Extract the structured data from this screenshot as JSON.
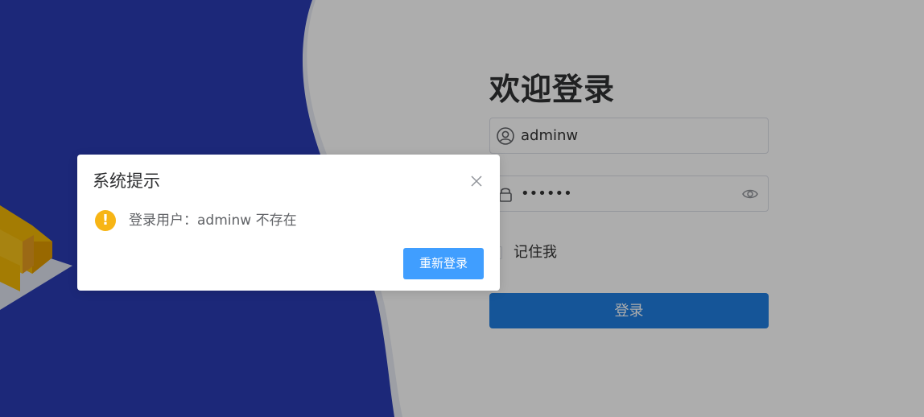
{
  "login": {
    "title": "欢迎登录",
    "username_value": "adminw",
    "password_value": "••••••",
    "remember_label": "记住我",
    "submit_label": "登录"
  },
  "dialog": {
    "title": "系统提示",
    "message": "登录用户：adminw 不存在",
    "warning_glyph": "!",
    "confirm_label": "重新登录"
  },
  "colors": {
    "left_panel": "#2a3cb3",
    "primary_button": "#1f7ee0",
    "dialog_button": "#409eff",
    "warning": "#f7b515"
  }
}
